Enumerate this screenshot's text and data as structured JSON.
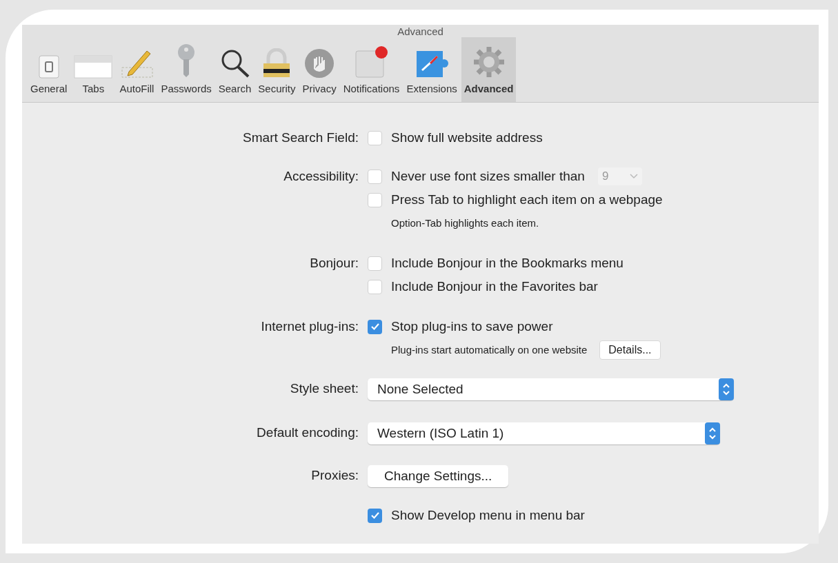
{
  "window": {
    "title": "Advanced"
  },
  "toolbar": [
    {
      "label": "General",
      "selected": false
    },
    {
      "label": "Tabs",
      "selected": false
    },
    {
      "label": "AutoFill",
      "selected": false
    },
    {
      "label": "Passwords",
      "selected": false
    },
    {
      "label": "Search",
      "selected": false
    },
    {
      "label": "Security",
      "selected": false
    },
    {
      "label": "Privacy",
      "selected": false
    },
    {
      "label": "Notifications",
      "selected": false
    },
    {
      "label": "Extensions",
      "selected": false
    },
    {
      "label": "Advanced",
      "selected": true
    }
  ],
  "sections": [
    {
      "label": "Smart Search Field:",
      "items": [
        {
          "kind": "checkbox",
          "label": "Show full website address",
          "checked": false
        }
      ]
    },
    {
      "label": "Accessibility:",
      "items": [
        {
          "kind": "checkbox",
          "label": "Never use font sizes smaller than",
          "checked": false,
          "select": {
            "value": "9",
            "disabled": true
          }
        },
        {
          "kind": "checkbox",
          "label": "Press Tab to highlight each item on a webpage",
          "checked": false
        },
        {
          "kind": "note",
          "text": "Option-Tab highlights each item."
        }
      ]
    },
    {
      "label": "Bonjour:",
      "items": [
        {
          "kind": "checkbox",
          "label": "Include Bonjour in the Bookmarks menu",
          "checked": false
        },
        {
          "kind": "checkbox",
          "label": "Include Bonjour in the Favorites bar",
          "checked": false
        }
      ]
    },
    {
      "label": "Internet plug-ins:",
      "items": [
        {
          "kind": "checkbox",
          "label": "Stop plug-ins to save power",
          "checked": true
        },
        {
          "kind": "note",
          "text": "Plug-ins start automatically on one website",
          "button": "Details..."
        }
      ]
    },
    {
      "label": "Style sheet:",
      "items": [
        {
          "kind": "popup",
          "value": "None Selected",
          "wide": true
        }
      ]
    },
    {
      "label": "Default encoding:",
      "items": [
        {
          "kind": "popup",
          "value": "Western (ISO Latin 1)",
          "wide": false
        }
      ]
    },
    {
      "label": "Proxies:",
      "items": [
        {
          "kind": "button",
          "label": "Change Settings..."
        }
      ]
    },
    {
      "items": [
        {
          "kind": "checkbox",
          "label": "Show Develop menu in menu bar",
          "checked": true
        }
      ]
    }
  ]
}
